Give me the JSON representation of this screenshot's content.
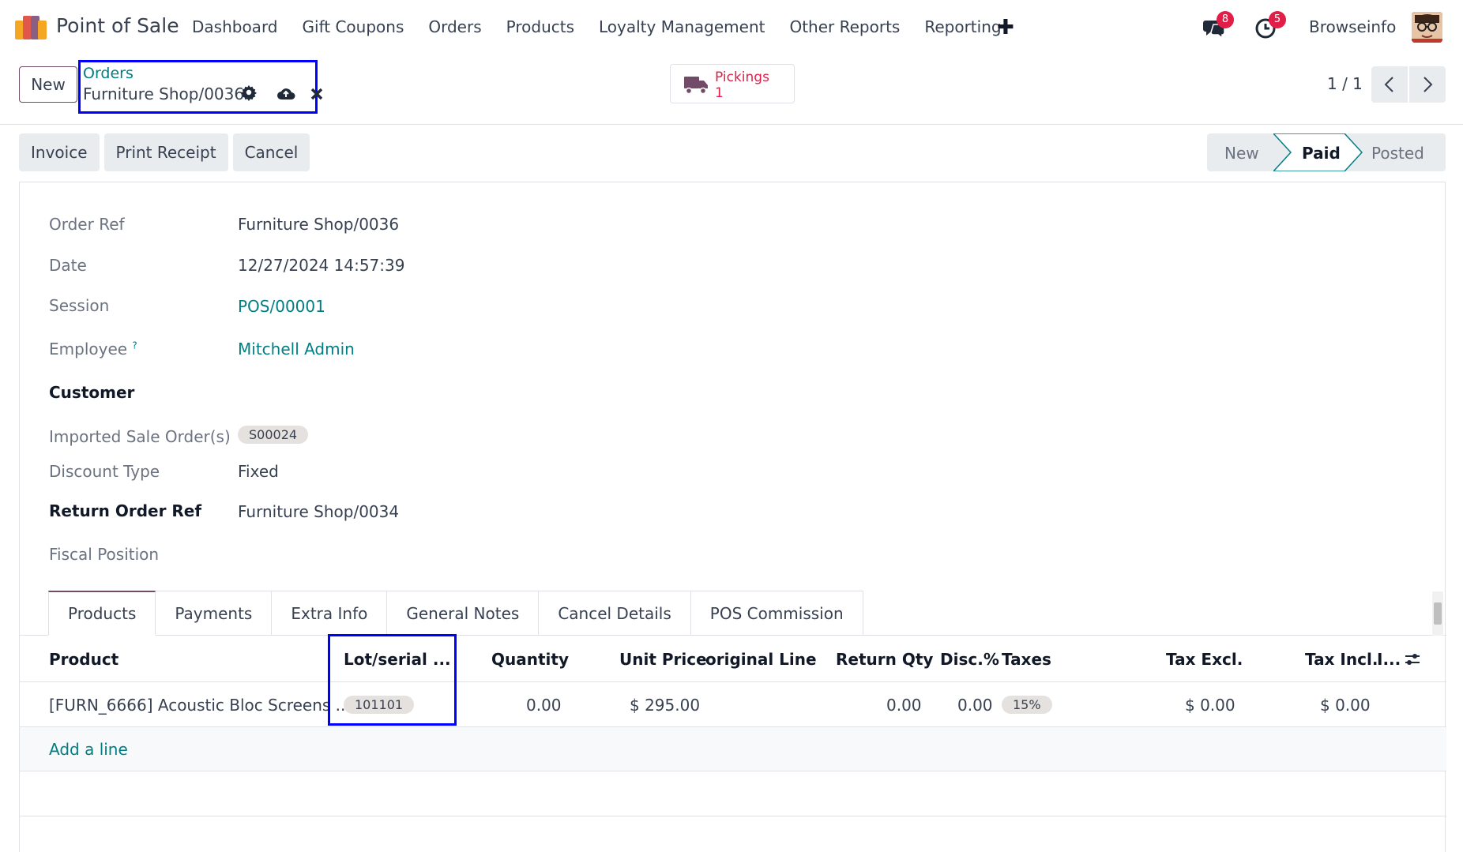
{
  "navbar": {
    "app_name": "Point of Sale",
    "menu": [
      "Dashboard",
      "Gift Coupons",
      "Orders",
      "Products",
      "Loyalty Management",
      "Other Reports",
      "Reporting"
    ],
    "chat_count": "8",
    "activity_count": "5",
    "company": "Browseinfo"
  },
  "control": {
    "new_label": "New",
    "breadcrumb_parent": "Orders",
    "breadcrumb_current": "Furniture Shop/0036",
    "pickings_label": "Pickings",
    "pickings_count": "1",
    "pager": "1 / 1"
  },
  "actions": {
    "invoice": "Invoice",
    "print_receipt": "Print Receipt",
    "cancel": "Cancel"
  },
  "status": {
    "new": "New",
    "paid": "Paid",
    "posted": "Posted"
  },
  "form": {
    "order_ref_label": "Order Ref",
    "order_ref": "Furniture Shop/0036",
    "date_label": "Date",
    "date": "12/27/2024 14:57:39",
    "session_label": "Session",
    "session": "POS/00001",
    "employee_label": "Employee",
    "employee_help": "?",
    "employee": "Mitchell Admin",
    "customer_label": "Customer",
    "imported_label": "Imported Sale Order(s)",
    "imported_tag": "S00024",
    "discount_type_label": "Discount Type",
    "discount_type": "Fixed",
    "return_ref_label": "Return Order Ref",
    "return_ref": "Furniture Shop/0034",
    "fiscal_label": "Fiscal Position"
  },
  "tabs": [
    "Products",
    "Payments",
    "Extra Info",
    "General Notes",
    "Cancel Details",
    "POS Commission"
  ],
  "table": {
    "headers": {
      "product": "Product",
      "lot": "Lot/serial ...",
      "quantity": "Quantity",
      "unit_price": "Unit Price",
      "original_line": "original Line",
      "return_qty": "Return Qty",
      "disc": "Disc.%",
      "taxes": "Taxes",
      "tax_excl": "Tax Excl.",
      "tax_incl": "Tax Incl.",
      "extra": "I..."
    },
    "row": {
      "product": "[FURN_6666] Acoustic Bloc Screens ...",
      "lot": "101101",
      "quantity": "0.00",
      "unit_price": "$ 295.00",
      "return_qty": "0.00",
      "disc": "0.00",
      "taxes": "15%",
      "tax_excl": "$ 0.00",
      "tax_incl": "$ 0.00"
    },
    "add_line": "Add a line"
  },
  "colors": {
    "brand": "#714b67",
    "link": "#017e84",
    "badge": "#e11d48",
    "highlight": "#0000ff"
  }
}
